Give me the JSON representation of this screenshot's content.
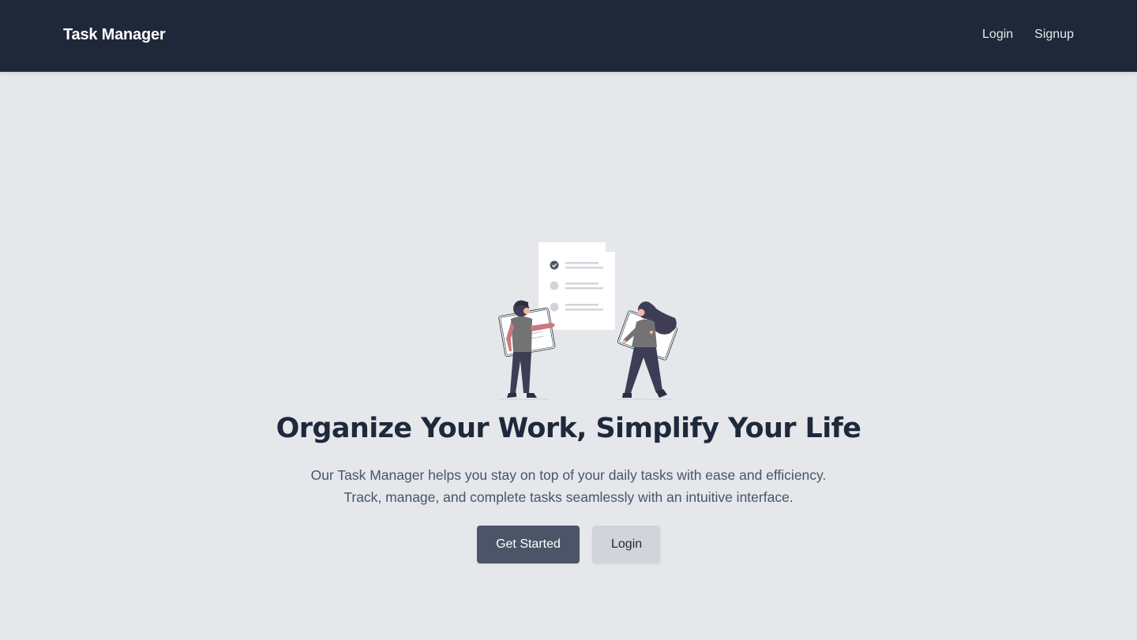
{
  "navbar": {
    "brand": "Task Manager",
    "links": [
      {
        "label": "Login"
      },
      {
        "label": "Signup"
      }
    ]
  },
  "hero": {
    "illustration_icon": "task-checklist-illustration",
    "headline": "Organize Your Work, Simplify Your Life",
    "subtitle_line_1": "Our Task Manager helps you stay on top of your daily tasks with ease and efficiency.",
    "subtitle_line_2": "Track, manage, and complete tasks seamlessly with an intuitive interface.",
    "primary_button": "Get Started",
    "secondary_button": "Login"
  },
  "colors": {
    "navbar_bg": "#1f2839",
    "page_bg": "#e5e7eb",
    "primary_button": "#4b5567",
    "secondary_button": "#d1d5db",
    "headline": "#1e293b"
  }
}
